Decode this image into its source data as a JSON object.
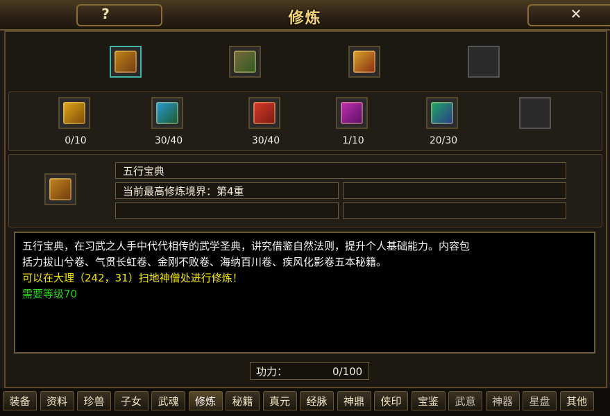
{
  "window": {
    "title": "修炼"
  },
  "titlebar": {
    "help_icon": "?",
    "close_icon": "✕"
  },
  "top_slots": [
    {
      "name": "wuxing-baodian",
      "color_a": "#c2861c",
      "color_b": "#6f3a10",
      "selected": true
    },
    {
      "name": "bamboo-scroll",
      "color_a": "#7a6a3a",
      "color_b": "#2e5a22"
    },
    {
      "name": "golden-book",
      "color_a": "#d9a430",
      "color_b": "#8a2a10"
    },
    {
      "name": "empty",
      "empty": true
    }
  ],
  "books": [
    {
      "color_a": "#e0a818",
      "color_b": "#7a4a08",
      "count": "0/10"
    },
    {
      "color_a": "#2a9ad6",
      "color_b": "#1a5a2a",
      "count": "30/40"
    },
    {
      "color_a": "#d63a2a",
      "color_b": "#7a1a10",
      "count": "30/40"
    },
    {
      "color_a": "#c030b0",
      "color_b": "#5a1060",
      "count": "1/10"
    },
    {
      "color_a": "#20a860",
      "color_b": "#2a3a8a",
      "count": "20/30"
    },
    {
      "empty": true,
      "count": ""
    }
  ],
  "info": {
    "book_name": "五行宝典",
    "realm": "当前最高修炼境界：第4重",
    "field_r1": "",
    "field_l3": "",
    "field_r3": ""
  },
  "description": {
    "line1": "五行宝典，在习武之人手中代代相传的武学圣典，讲究借鉴自然法则，提升个人基础能力。内容包",
    "line2": "括力拔山兮卷、气贯长虹卷、金刚不败卷、海纳百川卷、疾风化影卷五本秘籍。",
    "location": "可以在大理（242，31）扫地神僧处进行修炼！",
    "level": "需要等级70"
  },
  "gongli": {
    "label": "功力：",
    "value": "0/100"
  },
  "tabs": [
    "装备",
    "资料",
    "珍兽",
    "子女",
    "武魂",
    "修炼",
    "秘籍",
    "真元",
    "经脉",
    "神鼎",
    "侠印",
    "宝鉴",
    "武意",
    "神器",
    "星盘",
    "其他"
  ],
  "active_tab": "修炼"
}
